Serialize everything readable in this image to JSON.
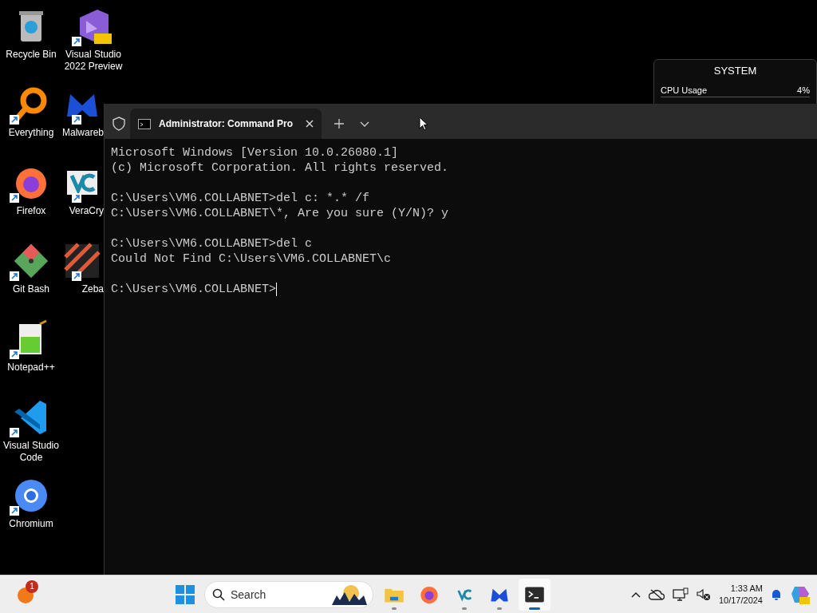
{
  "desktop_icons": [
    {
      "kind": "recycle",
      "label": "Recycle Bin",
      "cut": false,
      "shortcut": false
    },
    {
      "kind": "vs",
      "label": "Visual Studio 2022 Preview",
      "cut": false,
      "shortcut": true
    },
    {
      "kind": "everything",
      "label": "Everything",
      "cut": false,
      "shortcut": true
    },
    {
      "kind": "malware",
      "label": "Malwareb",
      "cut": true,
      "shortcut": true
    },
    {
      "kind": "firefox",
      "label": "Firefox",
      "cut": false,
      "shortcut": true
    },
    {
      "kind": "veracrypt",
      "label": "VeraCry",
      "cut": true,
      "shortcut": true
    },
    {
      "kind": "git",
      "label": "Git Bash",
      "cut": false,
      "shortcut": true
    },
    {
      "kind": "zebar",
      "label": "Zeba",
      "cut": true,
      "shortcut": true
    },
    {
      "kind": "notepad",
      "label": "Notepad++",
      "cut": false,
      "shortcut": true
    },
    {
      "kind": "vscode",
      "label": "Visual Studio Code",
      "cut": false,
      "shortcut": true
    },
    {
      "kind": "chromium",
      "label": "Chromium",
      "cut": false,
      "shortcut": true
    }
  ],
  "widget": {
    "title": "SYSTEM",
    "rows": [
      {
        "label": "CPU Usage",
        "value": "4%"
      }
    ]
  },
  "terminal": {
    "tab_title": "Administrator: Command Pro",
    "blocks": [
      [
        "Microsoft Windows [Version 10.0.26080.1]",
        "(c) Microsoft Corporation. All rights reserved."
      ],
      [
        "C:\\Users\\VM6.COLLABNET>del c: *.* /f",
        "C:\\Users\\VM6.COLLABNET\\*, Are you sure (Y/N)? y"
      ],
      [
        "C:\\Users\\VM6.COLLABNET>del c",
        "Could Not Find C:\\Users\\VM6.COLLABNET\\c"
      ],
      [
        "C:\\Users\\VM6.COLLABNET>"
      ]
    ]
  },
  "taskbar": {
    "badge": "1",
    "search_placeholder": "Search",
    "apps": [
      {
        "kind": "folder",
        "running": true,
        "selected": false
      },
      {
        "kind": "firefox",
        "running": false,
        "selected": false
      },
      {
        "kind": "veracrypt",
        "running": true,
        "selected": false
      },
      {
        "kind": "malware",
        "running": true,
        "selected": false
      },
      {
        "kind": "terminal",
        "running": true,
        "selected": true
      }
    ],
    "time": "1:33 AM",
    "date": "10/17/2024"
  }
}
